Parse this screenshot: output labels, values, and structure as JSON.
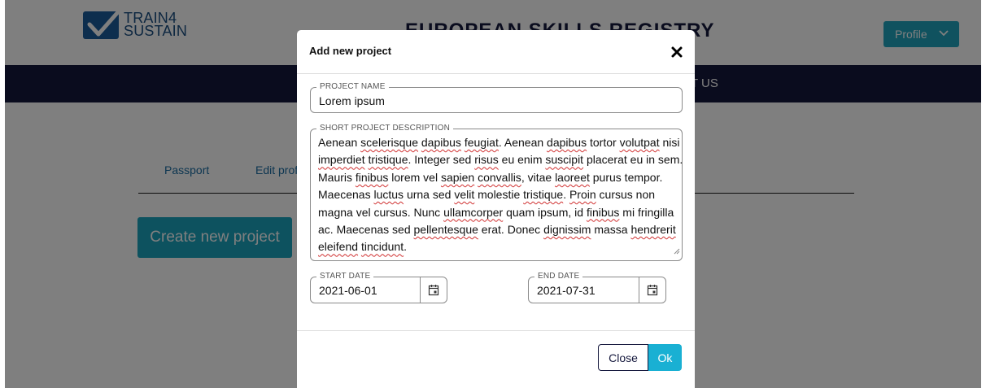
{
  "brand": {
    "line1": "TRAIN4",
    "line2": "SUSTAIN"
  },
  "site_title": "EUROPEAN SKILLS REGISTRY",
  "profile_button": "Profile",
  "nav": {
    "visible_item": "T US"
  },
  "tabs": [
    "Passport",
    "Edit prof"
  ],
  "create_button": "Create new project",
  "modal": {
    "title": "Add new project",
    "project_name": {
      "legend": "PROJECT NAME",
      "value": "Lorem ipsum"
    },
    "description": {
      "legend": "SHORT PROJECT DESCRIPTION",
      "value": "Aenean scelerisque dapibus feugiat. Aenean dapibus tortor volutpat nisi imperdiet tristique. Integer sed risus eu enim suscipit placerat eu in sem. Mauris finibus lorem vel sapien convallis, vitae laoreet purus tempor. Maecenas luctus urna sed velit molestie tristique. Proin cursus non magna vel cursus. Nunc ullamcorper quam ipsum, id finibus mi fringilla ac. Maecenas sed pellentesque erat. Donec dignissim massa hendrerit eleifend tincidunt."
    },
    "start_date": {
      "legend": "START DATE",
      "value": "2021-06-01"
    },
    "end_date": {
      "legend": "END DATE",
      "value": "2021-07-31"
    },
    "close_button": "Close",
    "ok_button": "Ok"
  },
  "colors": {
    "navy": "#15183d",
    "teal": "#1ba4bf",
    "ok_blue": "#19b0d3",
    "overlay": "rgba(0,0,0,0.5)"
  },
  "icons": [
    "checkmark-logo-icon",
    "chevron-down-icon",
    "close-icon",
    "calendar-icon",
    "resize-handle-icon"
  ]
}
